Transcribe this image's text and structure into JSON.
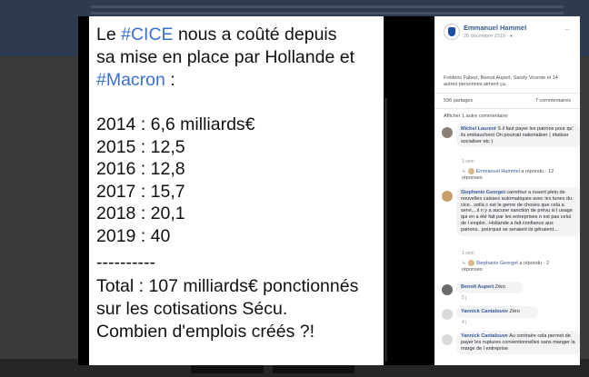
{
  "post_image": {
    "lines": [
      {
        "pre": "Le ",
        "tag": "#CICE",
        "post": " nous a coûté depuis"
      },
      {
        "pre": "sa mise en place par Hollande et",
        "tag": "",
        "post": ""
      },
      {
        "pre": "",
        "tag": "#Macron",
        "post": " :"
      },
      {
        "pre": "2014 : 6,6 milliards€",
        "tag": "",
        "post": ""
      },
      {
        "pre": "2015 : 12,5",
        "tag": "",
        "post": ""
      },
      {
        "pre": "2016 : 12,8",
        "tag": "",
        "post": ""
      },
      {
        "pre": "2017 : 15,7",
        "tag": "",
        "post": ""
      },
      {
        "pre": "2018 : 20,1",
        "tag": "",
        "post": ""
      },
      {
        "pre": "2019 : 40",
        "tag": "",
        "post": ""
      },
      {
        "pre": "----------",
        "tag": "",
        "post": ""
      },
      {
        "pre": "Total : 107 milliards€ ponctionnés",
        "tag": "",
        "post": ""
      },
      {
        "pre": "sur les cotisations Sécu.",
        "tag": "",
        "post": ""
      },
      {
        "pre": "Combien d'emplois créés ?!",
        "tag": "",
        "post": ""
      }
    ]
  },
  "panel": {
    "author": "Emmanuel Hammel",
    "date": "26 décembre 2019 · ",
    "menu": "···",
    "likes_text": "Frédéric Fabert, Benoit Aupert, Sandy Vicente et 14 autres personnes aiment ça.",
    "shares": "596 partages",
    "comments_count": "7 commentaires",
    "show_more": "Afficher 1 autre commentaire",
    "comments": [
      {
        "author": "Michel Laurent",
        "text": " S il faut payer les patrons pour qu' ils embauchent On pourrait nationaliser ( étatiser socialiser etc )",
        "time": "1 sem",
        "avatar_color": "#8a7f72",
        "reply": {
          "name": "Emmanuel Hammel",
          "text": " a répondu · 12 réponses"
        }
      },
      {
        "author": "Stephanie Georget",
        "text": " carrefour a ouvert plein de nouvelles caisses automatiques avec les tunes du cice...voilà c est le genre de choses que cela a servi....il n y a aucune sanction de prévu si l usage qui en a été fait par les entreprises n est pas celui de l emploi.. Hollande a fait confiance aux patrons...pourquoi se seraient ils gênaient...",
        "time": "1 sem",
        "avatar_color": "#c9a06a",
        "reply": {
          "name": "Stephanie Georget",
          "text": " a répondu · 2 réponses"
        }
      },
      {
        "author": "Benoit Aupert",
        "text": " Zéro",
        "time": "5 j",
        "avatar_color": "#6b6b6b"
      },
      {
        "author": "Yannick Cantalouve",
        "text": " Zéro",
        "time": "4 j",
        "avatar_color": "#d9d9d9"
      },
      {
        "author": "Yannick Cantalouve",
        "text": " Au contraire cela permet de payer les ruptures conventionnelles sans manger la marge de l entreprise",
        "time": "",
        "avatar_color": "#d9d9d9"
      }
    ]
  }
}
